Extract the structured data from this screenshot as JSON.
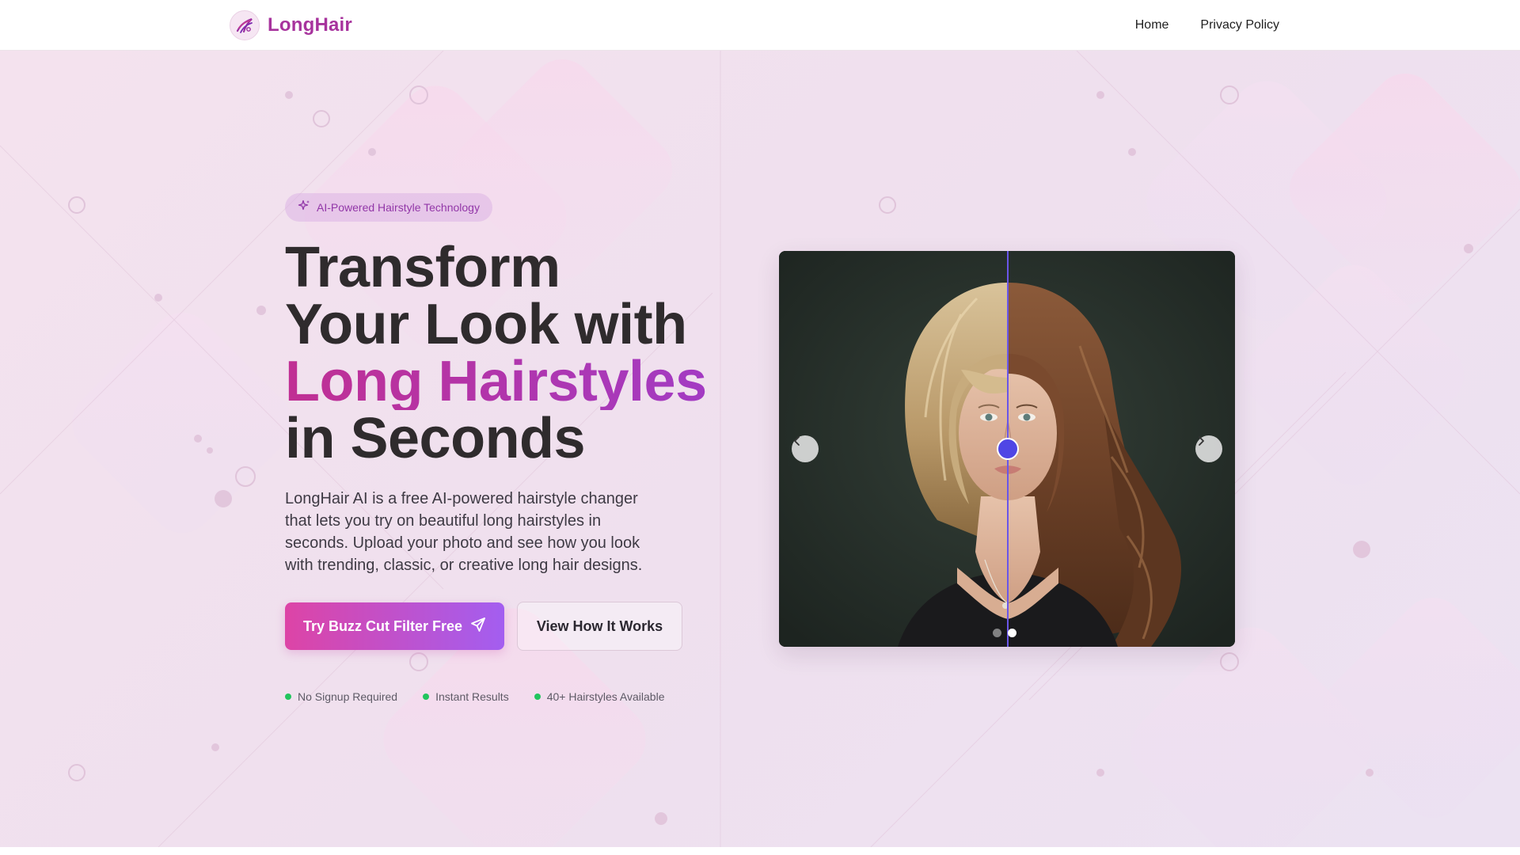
{
  "header": {
    "brand": "LongHair",
    "nav": [
      {
        "label": "Home"
      },
      {
        "label": "Privacy Policy"
      }
    ]
  },
  "hero": {
    "badge": "AI-Powered Hairstyle Technology",
    "headline": {
      "line1": "Transform",
      "line2": "Your Look with",
      "accent": "Long Hairstyles",
      "line4": "in Seconds"
    },
    "description": "LongHair AI is a free AI-powered hairstyle changer that lets you try on beautiful long hairstyles in seconds. Upload your photo and see how you look with trending, classic, or creative long hair designs.",
    "primary_cta": "Try Buzz Cut Filter Free",
    "secondary_cta": "View How It Works",
    "features": [
      {
        "label": "No Signup Required"
      },
      {
        "label": "Instant Results"
      },
      {
        "label": "40+ Hairstyles Available"
      }
    ]
  },
  "comparison": {
    "slider_position": 0.5,
    "slides_total": 2,
    "active_slide": 2
  },
  "colors": {
    "brand": "#a7339d",
    "accent_start": "#c02f93",
    "accent_end": "#9f3cc9",
    "cta_start": "#dd44a6",
    "cta_end": "#a35ef0",
    "divider": "#6a56e8",
    "handle": "#4f46e5",
    "feature_dot": "#22c55e"
  }
}
